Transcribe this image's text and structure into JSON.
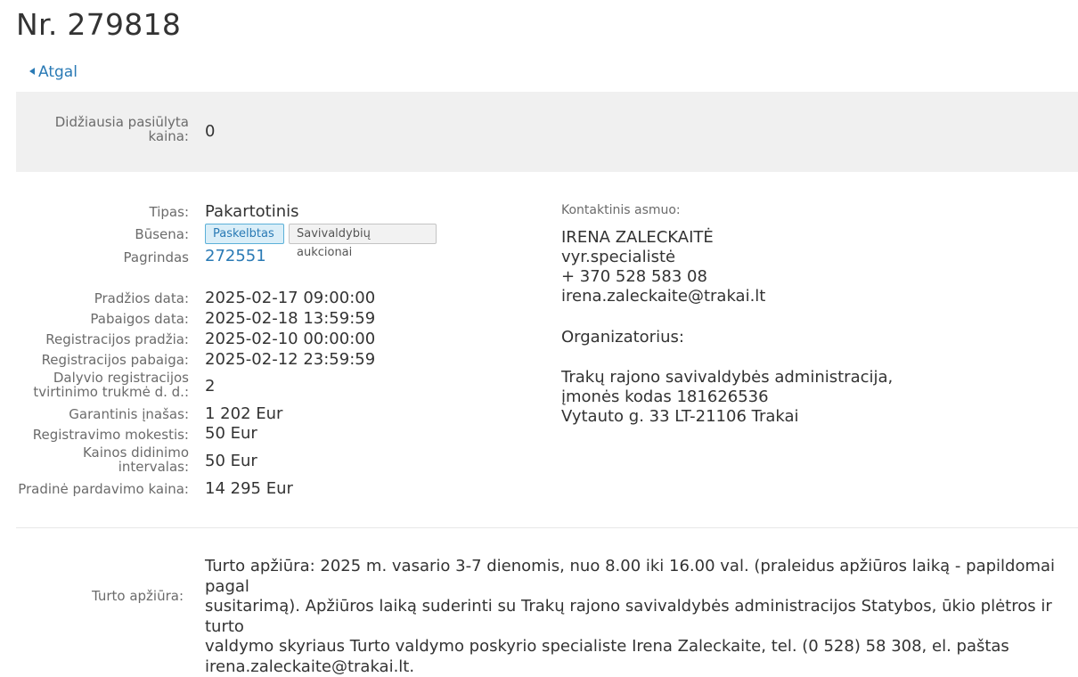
{
  "header": {
    "title": "Nr. 279818",
    "back_label": "Atgal"
  },
  "highest_bid": {
    "label_line1": "Didžiausia pasiūlyta",
    "label_line2": "kaina:",
    "value": "0"
  },
  "details": {
    "type_label": "Tipas:",
    "type_value": "Pakartotinis",
    "status_label": "Būsena:",
    "status_badge_primary": "Paskelbtas",
    "status_badge_secondary": "Savivaldybių aukcionai",
    "basis_label": "Pagrindas",
    "basis_value": "272551",
    "start_date_label": "Pradžios data:",
    "start_date_value": "2025-02-17 09:00:00",
    "end_date_label": "Pabaigos data:",
    "end_date_value": "2025-02-18 13:59:59",
    "reg_start_label": "Registracijos pradžia:",
    "reg_start_value": "2025-02-10 00:00:00",
    "reg_end_label": "Registracijos pabaiga:",
    "reg_end_value": "2025-02-12 23:59:59",
    "confirm_label_line1": "Dalyvio registracijos",
    "confirm_label_line2": "tvirtinimo trukmė d. d.:",
    "confirm_value": "2",
    "deposit_label": "Garantinis įnašas:",
    "deposit_value": "1 202 Eur",
    "reg_fee_label": "Registravimo mokestis:",
    "reg_fee_value": "50 Eur",
    "increment_label_line1": "Kainos didinimo",
    "increment_label_line2": "intervalas:",
    "increment_value": "50 Eur",
    "initial_price_label": "Pradinė pardavimo kaina:",
    "initial_price_value": "14 295 Eur"
  },
  "contact": {
    "label": "Kontaktinis asmuo:",
    "name": "IRENA ZALECKAITĖ",
    "position": "vyr.specialistė",
    "phone": "+ 370 528 583 08",
    "email": "irena.zaleckaite@trakai.lt",
    "organizer_label": "Organizatorius:",
    "org_line1": "Trakų rajono savivaldybės administracija,",
    "org_line2": "įmonės kodas 181626536",
    "org_line3": "Vytauto g. 33 LT-21106 Trakai"
  },
  "viewing": {
    "label": "Turto apžiūra:",
    "line1": "Turto apžiūra: 2025 m. vasario 3-7 dienomis, nuo 8.00 iki 16.00 val. (praleidus apžiūros laiką - papildomai pagal",
    "line2": "susitarimą). Apžiūros laiką suderinti su Trakų rajono savivaldybės administracijos Statybos, ūkio plėtros ir turto",
    "line3": "valdymo skyriaus Turto valdymo poskyrio specialiste Irena Zaleckaite, tel. (0 528) 58 308, el. paštas",
    "line4": "irena.zaleckaite@trakai.lt."
  }
}
